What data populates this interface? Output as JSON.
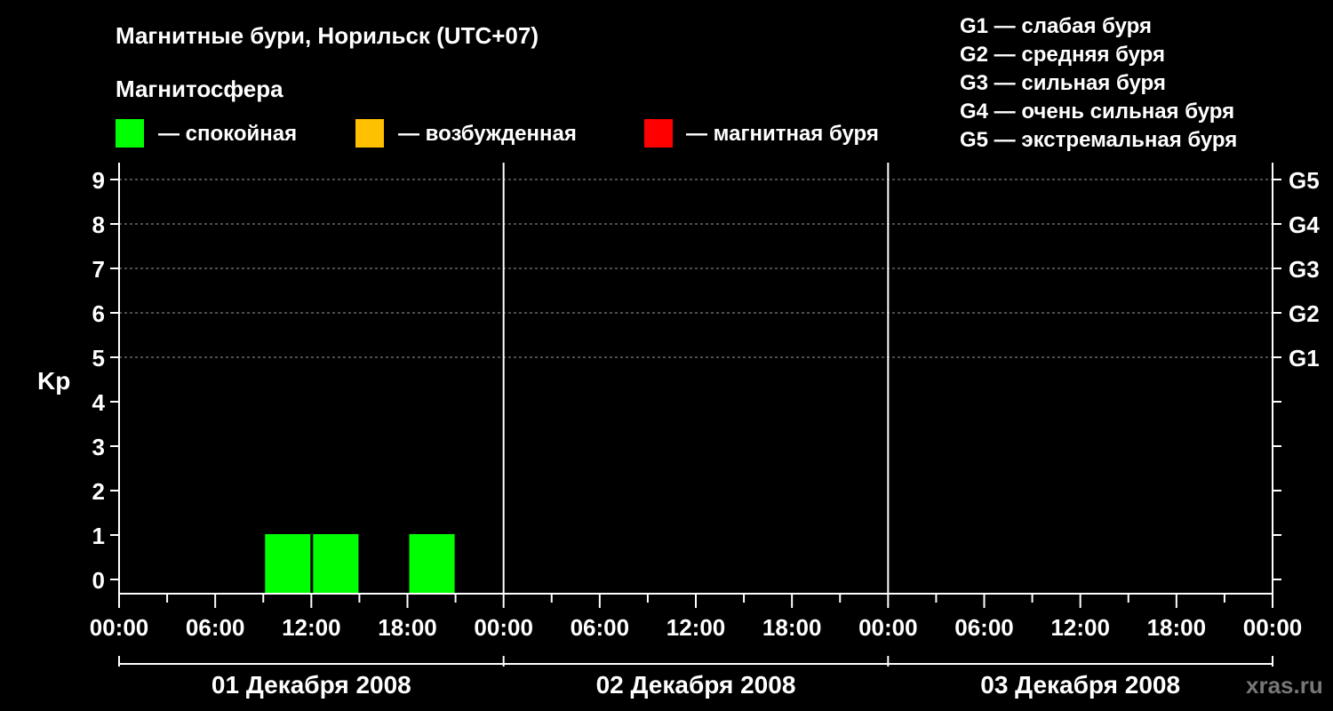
{
  "chart_data": {
    "type": "bar",
    "title": "Магнитные бури, Норильск (UTC+07)",
    "legend": {
      "title": "Магнитосфера",
      "items": [
        {
          "label": "— спокойная",
          "color": "#00ff00"
        },
        {
          "label": "— возбужденная",
          "color": "#ffc000"
        },
        {
          "label": "— магнитная буря",
          "color": "#ff0000"
        }
      ]
    },
    "storm_levels": [
      "G1 — слабая буря",
      "G2 — средняя буря",
      "G3 — сильная буря",
      "G4 — очень сильная буря",
      "G5 — экстремальная буря"
    ],
    "ylabel": "Kp",
    "ylim": [
      0,
      9
    ],
    "y_ticks": [
      "0",
      "1",
      "2",
      "3",
      "4",
      "5",
      "6",
      "7",
      "8",
      "9"
    ],
    "right_axis_labels": [
      {
        "kp": 5,
        "label": "G1"
      },
      {
        "kp": 6,
        "label": "G2"
      },
      {
        "kp": 7,
        "label": "G3"
      },
      {
        "kp": 8,
        "label": "G4"
      },
      {
        "kp": 9,
        "label": "G5"
      }
    ],
    "xlim_hours": [
      0,
      72
    ],
    "x_tick_labels": [
      "00:00",
      "06:00",
      "12:00",
      "18:00",
      "00:00",
      "06:00",
      "12:00",
      "18:00",
      "00:00",
      "06:00",
      "12:00",
      "18:00",
      "00:00"
    ],
    "days": [
      "01 Декабря 2008",
      "02 Декабря 2008",
      "03 Декабря 2008"
    ],
    "grid": true,
    "bars": [
      {
        "start_hour": 9,
        "end_hour": 12,
        "kp": 1,
        "status": "спокойная",
        "color": "#00ff00"
      },
      {
        "start_hour": 12,
        "end_hour": 15,
        "kp": 1,
        "status": "спокойная",
        "color": "#00ff00"
      },
      {
        "start_hour": 18,
        "end_hour": 21,
        "kp": 1,
        "status": "спокойная",
        "color": "#00ff00"
      }
    ],
    "source": "xras.ru"
  }
}
